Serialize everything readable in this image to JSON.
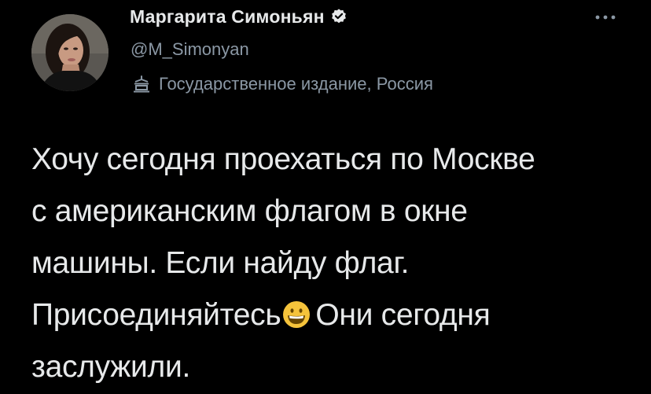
{
  "author": {
    "display_name": "Маргарита Симоньян",
    "handle": "@M_Simonyan",
    "verified": true,
    "verified_icon": "verified-badge-icon",
    "label_icon": "state-media-icon",
    "label": "Государственное издание, Россия"
  },
  "more_icon": "more-options-icon",
  "tweet": {
    "lines": [
      "Хочу сегодня проехаться по Москве",
      "с американским флагом в окне",
      "машины. Если найду флаг.",
      "Присоединяйтесь",
      "Они сегодня",
      "заслужили."
    ],
    "emoji": "grinning-face-emoji"
  },
  "colors": {
    "background": "#000000",
    "primary_text": "#e7e9ea",
    "secondary_text": "#8b98a5",
    "emoji_yellow": "#f5c33b"
  }
}
